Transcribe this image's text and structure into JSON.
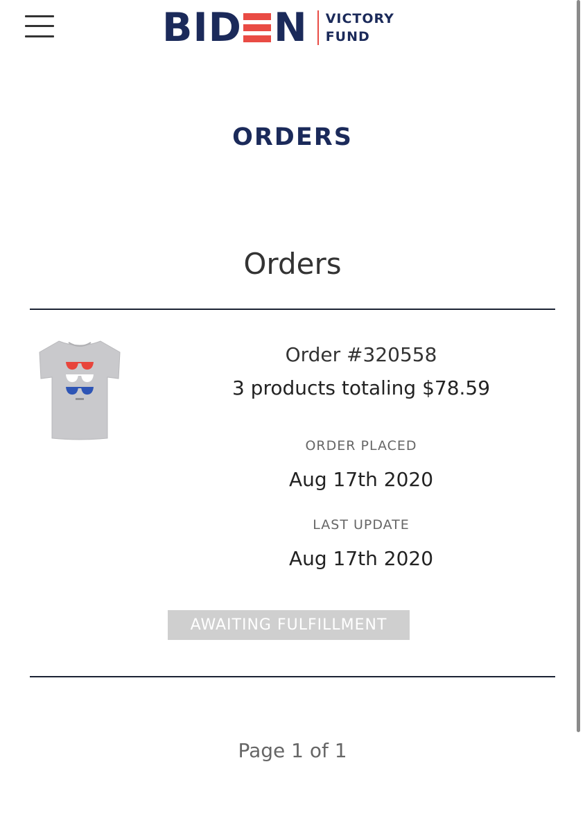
{
  "header": {
    "logo": {
      "word_left": "BID",
      "word_right": "N",
      "sub_line_1": "VICTORY",
      "sub_line_2": "FUND",
      "colors": {
        "navy": "#1b2a5a",
        "red": "#e94b44"
      }
    },
    "menu_icon": "hamburger-menu-icon"
  },
  "page": {
    "heading": "ORDERS",
    "section_title": "Orders",
    "pagination": "Page 1 of 1"
  },
  "orders": [
    {
      "thumbnail_icon": "tshirt-icon",
      "order_number": "Order #320558",
      "summary": "3 products totaling $78.59",
      "placed_label": "ORDER PLACED",
      "placed_date": "Aug 17th 2020",
      "updated_label": "LAST UPDATE",
      "updated_date": "Aug 17th 2020",
      "status": "AWAITING FULFILLMENT"
    }
  ]
}
